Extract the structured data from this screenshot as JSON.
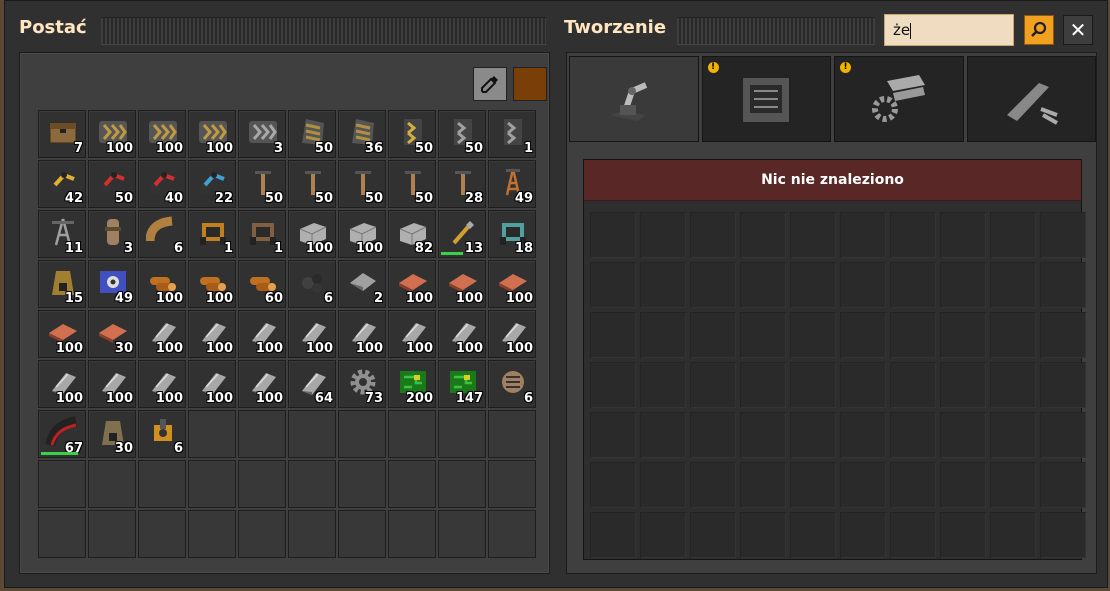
{
  "left_title": "Postać",
  "right_title": "Tworzenie",
  "search": {
    "value": "że"
  },
  "close_label": "✕",
  "logistics_color": "#7a3e08",
  "not_found": "Nic nie znaleziono",
  "crafting_tabs": [
    {
      "name": "logistics-tab",
      "icon": "inserter-icon",
      "warning": false
    },
    {
      "name": "production-tab",
      "icon": "assembler-icon",
      "warning": true
    },
    {
      "name": "intermediate-tab",
      "icon": "gear-plates-icon",
      "warning": true
    },
    {
      "name": "combat-tab",
      "icon": "gun-icon",
      "warning": false
    }
  ],
  "inventory": [
    {
      "icon": "wooden-chest",
      "color": "#8b6b3e",
      "count": "7"
    },
    {
      "icon": "transport-belt",
      "color": "#c09a40",
      "count": "100"
    },
    {
      "icon": "transport-belt",
      "color": "#c09a40",
      "count": "100"
    },
    {
      "icon": "transport-belt",
      "color": "#c09a40",
      "count": "100"
    },
    {
      "icon": "transport-belt",
      "color": "#a8a8a8",
      "count": "3"
    },
    {
      "icon": "underground-belt",
      "color": "#b09040",
      "count": "50"
    },
    {
      "icon": "underground-belt",
      "color": "#b09040",
      "count": "36"
    },
    {
      "icon": "splitter",
      "color": "#d0b040",
      "count": "50"
    },
    {
      "icon": "splitter",
      "color": "#a0a0a0",
      "count": "50"
    },
    {
      "icon": "splitter",
      "color": "#a0a0a0",
      "count": "1"
    },
    {
      "icon": "inserter",
      "color": "#e0b030",
      "count": "42"
    },
    {
      "icon": "long-inserter",
      "color": "#d03030",
      "count": "50"
    },
    {
      "icon": "long-inserter",
      "color": "#d03030",
      "count": "40"
    },
    {
      "icon": "fast-inserter",
      "color": "#40a0d0",
      "count": "22"
    },
    {
      "icon": "small-pole",
      "color": "#b08050",
      "count": "50"
    },
    {
      "icon": "small-pole",
      "color": "#b08050",
      "count": "50"
    },
    {
      "icon": "small-pole",
      "color": "#b08050",
      "count": "50"
    },
    {
      "icon": "small-pole",
      "color": "#b08050",
      "count": "50"
    },
    {
      "icon": "small-pole",
      "color": "#b08050",
      "count": "28"
    },
    {
      "icon": "medium-pole",
      "color": "#c07030",
      "count": "49"
    },
    {
      "icon": "big-pole",
      "color": "#a0a0a0",
      "count": "11"
    },
    {
      "icon": "pipe-to-ground",
      "color": "#a08060",
      "count": "3"
    },
    {
      "icon": "pipe",
      "color": "#b08040",
      "count": "6"
    },
    {
      "icon": "burner-drill",
      "color": "#c08020",
      "count": "1"
    },
    {
      "icon": "burner-drill",
      "color": "#806040",
      "count": "1"
    },
    {
      "icon": "stone-brick",
      "color": "#b0b0b0",
      "count": "100"
    },
    {
      "icon": "stone-brick",
      "color": "#b0b0b0",
      "count": "100"
    },
    {
      "icon": "stone-brick",
      "color": "#b0b0b0",
      "count": "82"
    },
    {
      "icon": "repair-pack",
      "color": "#d0a030",
      "count": "13",
      "bar": 0.5
    },
    {
      "icon": "electric-drill",
      "color": "#50a0a0",
      "count": "18"
    },
    {
      "icon": "stone-furnace",
      "color": "#a08030",
      "count": "15"
    },
    {
      "icon": "lab",
      "color": "#4050c0",
      "count": "49"
    },
    {
      "icon": "wood",
      "color": "#c07020",
      "count": "100"
    },
    {
      "icon": "wood",
      "color": "#c07020",
      "count": "100"
    },
    {
      "icon": "wood",
      "color": "#c07020",
      "count": "60"
    },
    {
      "icon": "coal",
      "color": "#404040",
      "count": "6"
    },
    {
      "icon": "iron-ore",
      "color": "#a0a0a0",
      "count": "2"
    },
    {
      "icon": "copper-plate",
      "color": "#d07050",
      "count": "100"
    },
    {
      "icon": "copper-plate",
      "color": "#d07050",
      "count": "100"
    },
    {
      "icon": "copper-plate",
      "color": "#d07050",
      "count": "100"
    },
    {
      "icon": "copper-plate",
      "color": "#d07050",
      "count": "100"
    },
    {
      "icon": "copper-plate",
      "color": "#d07050",
      "count": "30"
    },
    {
      "icon": "iron-plate",
      "color": "#a8a8a8",
      "count": "100"
    },
    {
      "icon": "iron-plate",
      "color": "#a8a8a8",
      "count": "100"
    },
    {
      "icon": "iron-plate",
      "color": "#a8a8a8",
      "count": "100"
    },
    {
      "icon": "iron-plate",
      "color": "#a8a8a8",
      "count": "100"
    },
    {
      "icon": "iron-plate",
      "color": "#a8a8a8",
      "count": "100"
    },
    {
      "icon": "iron-plate",
      "color": "#a8a8a8",
      "count": "100"
    },
    {
      "icon": "iron-plate",
      "color": "#a8a8a8",
      "count": "100"
    },
    {
      "icon": "iron-plate",
      "color": "#a8a8a8",
      "count": "100"
    },
    {
      "icon": "iron-plate",
      "color": "#a8a8a8",
      "count": "100"
    },
    {
      "icon": "iron-plate",
      "color": "#a8a8a8",
      "count": "100"
    },
    {
      "icon": "iron-plate",
      "color": "#a8a8a8",
      "count": "100"
    },
    {
      "icon": "iron-plate",
      "color": "#a8a8a8",
      "count": "100"
    },
    {
      "icon": "iron-plate",
      "color": "#a8a8a8",
      "count": "100"
    },
    {
      "icon": "iron-plate",
      "color": "#a8a8a8",
      "count": "64"
    },
    {
      "icon": "iron-gear",
      "color": "#909090",
      "count": "73"
    },
    {
      "icon": "circuit",
      "color": "#40c040",
      "count": "200"
    },
    {
      "icon": "circuit",
      "color": "#40c040",
      "count": "147"
    },
    {
      "icon": "engine",
      "color": "#a08060",
      "count": "6"
    },
    {
      "icon": "rail",
      "color": "#c02020",
      "count": "67",
      "bar": 0.85
    },
    {
      "icon": "stone-furnace",
      "color": "#807050",
      "count": "30"
    },
    {
      "icon": "turret",
      "color": "#d09020",
      "count": "6"
    },
    {
      "icon": "empty"
    },
    {
      "icon": "empty"
    },
    {
      "icon": "empty"
    },
    {
      "icon": "empty"
    },
    {
      "icon": "empty"
    },
    {
      "icon": "empty"
    },
    {
      "icon": "empty"
    },
    {
      "icon": "empty"
    },
    {
      "icon": "empty"
    },
    {
      "icon": "empty"
    },
    {
      "icon": "empty"
    },
    {
      "icon": "empty"
    },
    {
      "icon": "empty"
    },
    {
      "icon": "empty"
    },
    {
      "icon": "empty"
    },
    {
      "icon": "empty"
    },
    {
      "icon": "empty"
    },
    {
      "icon": "empty"
    },
    {
      "icon": "empty"
    },
    {
      "icon": "empty"
    },
    {
      "icon": "empty"
    },
    {
      "icon": "empty"
    },
    {
      "icon": "empty"
    },
    {
      "icon": "empty"
    },
    {
      "icon": "empty"
    },
    {
      "icon": "empty"
    },
    {
      "icon": "empty"
    }
  ]
}
